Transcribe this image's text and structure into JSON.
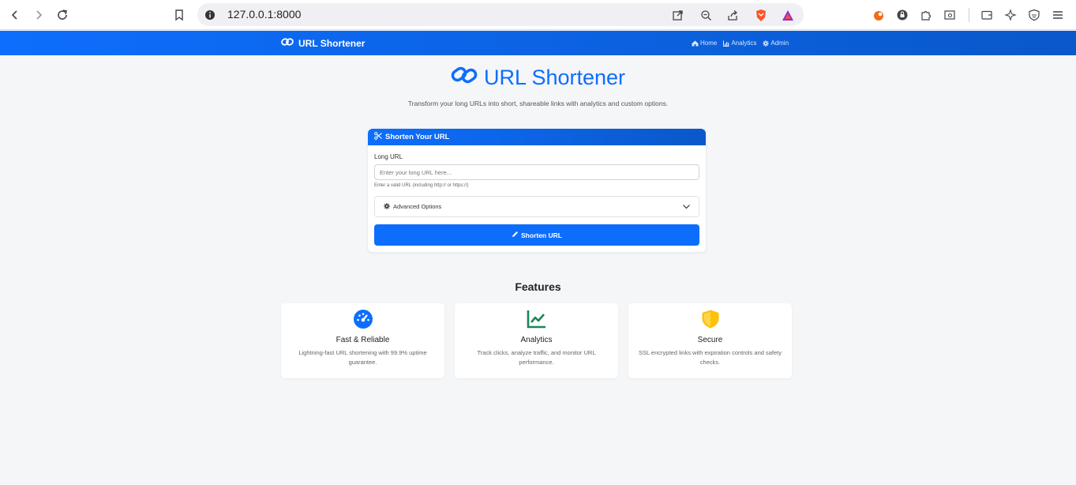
{
  "browser": {
    "url": "127.0.0.1:8000"
  },
  "navbar": {
    "brand": "URL Shortener",
    "links": [
      {
        "label": "Home",
        "icon": "home-icon"
      },
      {
        "label": "Analytics",
        "icon": "bar-chart-icon"
      },
      {
        "label": "Admin",
        "icon": "gear-icon"
      }
    ]
  },
  "hero": {
    "title": "URL Shortener",
    "subtitle": "Transform your long URLs into short, shareable links with analytics and custom options."
  },
  "form": {
    "header": "Shorten Your URL",
    "long_url_label": "Long URL",
    "long_url_placeholder": "Enter your long URL here...",
    "long_url_value": "",
    "help_text": "Enter a valid URL (including http:// or https://)",
    "advanced_label": "Advanced Options",
    "submit_label": "Shorten URL"
  },
  "features": {
    "title": "Features",
    "items": [
      {
        "title": "Fast & Reliable",
        "description": "Lightning-fast URL shortening with 99.9% uptime guarantee.",
        "icon": "speedometer-icon",
        "color": "#0d6efd"
      },
      {
        "title": "Analytics",
        "description": "Track clicks, analyze traffic, and monitor URL performance.",
        "icon": "line-chart-icon",
        "color": "#198754"
      },
      {
        "title": "Secure",
        "description": "SSL encrypted links with expiration controls and safety checks.",
        "icon": "shield-icon",
        "color": "#ffc107"
      }
    ]
  },
  "colors": {
    "primary": "#0d6efd",
    "success": "#198754",
    "warning": "#ffc107",
    "background": "#f5f6f8"
  }
}
